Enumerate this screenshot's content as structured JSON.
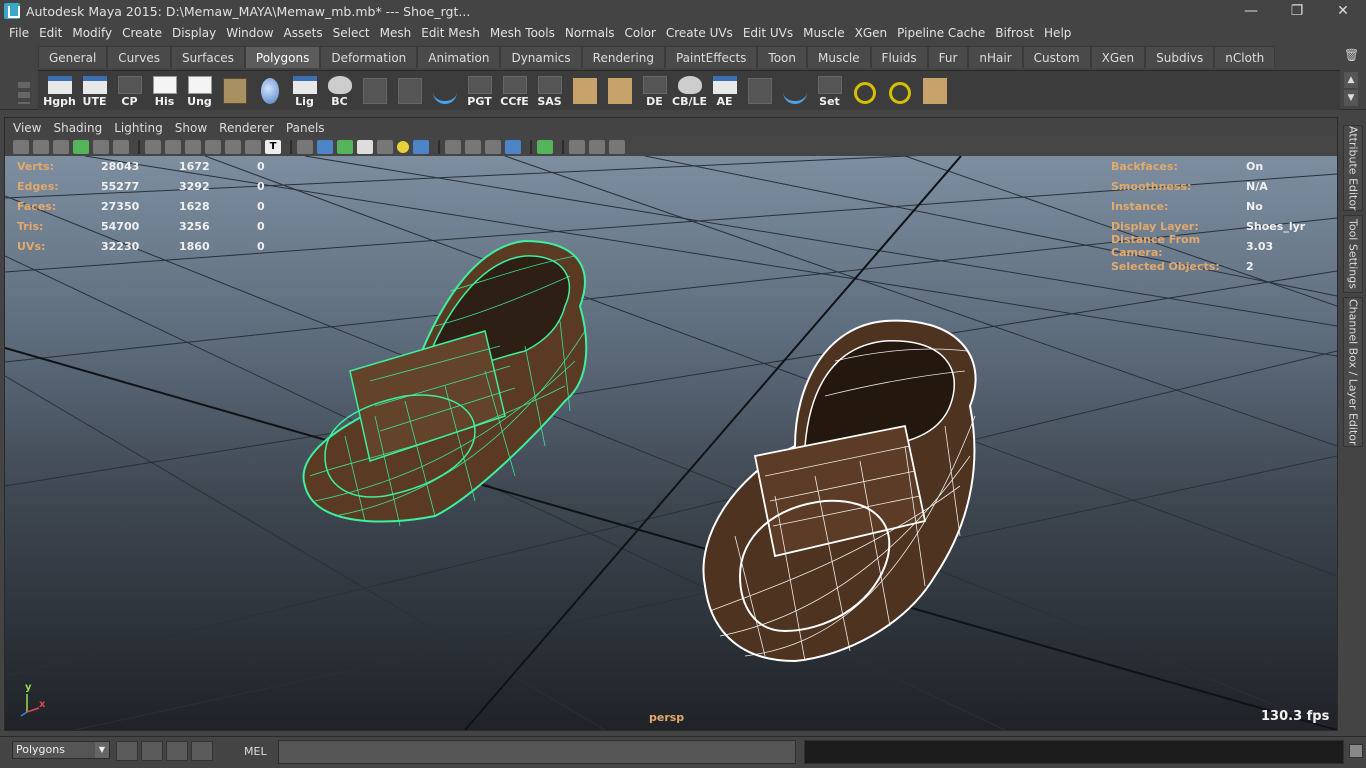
{
  "window": {
    "title": "Autodesk Maya 2015: D:\\Memaw_MAYA\\Memaw_mb.mb*   ---   Shoe_rgt...",
    "minimize": "—",
    "maximize": "❐",
    "close": "✕"
  },
  "menubar": [
    "File",
    "Edit",
    "Modify",
    "Create",
    "Display",
    "Window",
    "Assets",
    "Select",
    "Mesh",
    "Edit Mesh",
    "Mesh Tools",
    "Normals",
    "Color",
    "Create UVs",
    "Edit UVs",
    "Muscle",
    "XGen",
    "Pipeline Cache",
    "Bifrost",
    "Help"
  ],
  "shelf": {
    "tabs": [
      "General",
      "Curves",
      "Surfaces",
      "Polygons",
      "Deformation",
      "Animation",
      "Dynamics",
      "Rendering",
      "PaintEffects",
      "Toon",
      "Muscle",
      "Fluids",
      "Fur",
      "nHair",
      "Custom",
      "XGen",
      "Subdivs",
      "nCloth"
    ],
    "active_tab": "Polygons",
    "buttons": [
      {
        "label": "Hgph",
        "icon": "hypergraph-icon"
      },
      {
        "label": "UTE",
        "icon": "uv-texture-editor-icon"
      },
      {
        "label": "CP",
        "icon": "component-pivot-icon"
      },
      {
        "label": "His",
        "icon": "history-icon"
      },
      {
        "label": "Ung",
        "icon": "ungroup-icon"
      },
      {
        "label": "",
        "icon": "box-icon"
      },
      {
        "label": "",
        "icon": "globe-select-icon"
      },
      {
        "label": "Lig",
        "icon": "light-editor-icon"
      },
      {
        "label": "BC",
        "icon": "bake-camera-icon"
      },
      {
        "label": "",
        "icon": "joint-tool-icon"
      },
      {
        "label": "",
        "icon": "camera-rig-icon"
      },
      {
        "label": "",
        "icon": "curve-tool-icon"
      },
      {
        "label": "PGT",
        "icon": "pgt-icon"
      },
      {
        "label": "CCfE",
        "icon": "ccfe-icon"
      },
      {
        "label": "SAS",
        "icon": "sas-icon"
      },
      {
        "label": "",
        "icon": "uv-layout-icon"
      },
      {
        "label": "",
        "icon": "tile-icon"
      },
      {
        "label": "DE",
        "icon": "display-effects-icon"
      },
      {
        "label": "CB/LE",
        "icon": "channel-box-layer-editor-icon"
      },
      {
        "label": "AE",
        "icon": "attribute-editor-icon"
      },
      {
        "label": "",
        "icon": "brush-icon"
      },
      {
        "label": "",
        "icon": "spline-icon"
      },
      {
        "label": "Set",
        "icon": "set-key-icon"
      },
      {
        "label": "",
        "icon": "target-icon"
      },
      {
        "label": "",
        "icon": "color-wheel-icon"
      },
      {
        "label": "",
        "icon": "uv-grid-icon"
      }
    ]
  },
  "panel": {
    "menus": [
      "View",
      "Shading",
      "Lighting",
      "Show",
      "Renderer",
      "Panels"
    ]
  },
  "hud": {
    "stats": [
      {
        "key": "Verts:",
        "a": "28043",
        "b": "1672",
        "c": "0"
      },
      {
        "key": "Edges:",
        "a": "55277",
        "b": "3292",
        "c": "0"
      },
      {
        "key": "Faces:",
        "a": "27350",
        "b": "1628",
        "c": "0"
      },
      {
        "key": "Tris:",
        "a": "54700",
        "b": "3256",
        "c": "0"
      },
      {
        "key": "UVs:",
        "a": "32230",
        "b": "1860",
        "c": "0"
      }
    ],
    "object_info": [
      {
        "key": "Backfaces:",
        "value": "On"
      },
      {
        "key": "Smoothness:",
        "value": "N/A"
      },
      {
        "key": "Instance:",
        "value": "No"
      },
      {
        "key": "Display Layer:",
        "value": "Shoes_lyr"
      },
      {
        "key": "Distance From Camera:",
        "value": "3.03"
      },
      {
        "key": "Selected Objects:",
        "value": "2"
      }
    ],
    "camera": "persp",
    "fps": "130.3 fps",
    "axis_y": "y",
    "axis_x": "x"
  },
  "side_tabs": [
    "Attribute Editor",
    "Tool Settings",
    "Channel Box / Layer Editor"
  ],
  "commandline": {
    "mode": "Polygons",
    "language": "MEL",
    "input_value": ""
  },
  "colors": {
    "ui_bg": "#444444",
    "hud_key": "#e3a96b",
    "selection_wire": "#3cf0a0",
    "wire_white": "#ffffff",
    "shoe_leather": "#5a3a22"
  }
}
